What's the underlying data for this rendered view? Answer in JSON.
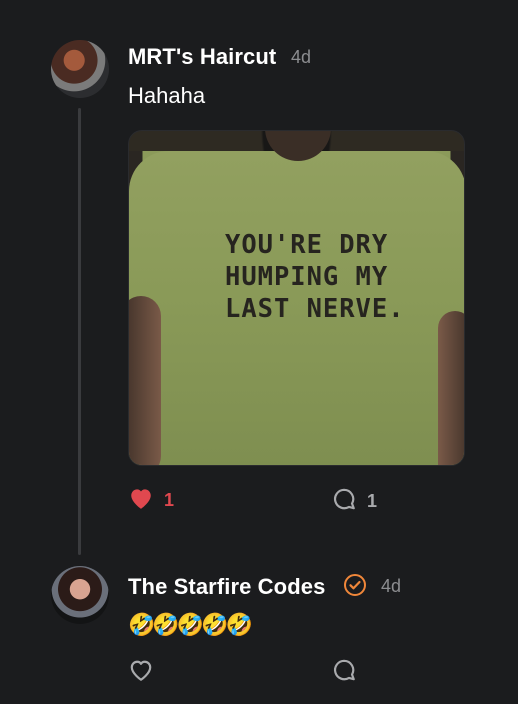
{
  "comments": [
    {
      "author": "MRT's Haircut",
      "time": "4d",
      "text": "Hahaha",
      "attachment": {
        "shirt_text": "YOU'RE DRY\nHUMPING MY\nLAST NERVE."
      },
      "likes": "1",
      "replies": "1",
      "liked": true,
      "avatar_icon": "avatar-photo"
    },
    {
      "author": "The Starfire Codes",
      "time": "4d",
      "verified_icon": "verified-check-icon",
      "text": "🤣🤣🤣🤣🤣",
      "avatar_icon": "avatar-photo"
    }
  ],
  "colors": {
    "background": "#1b1c1e",
    "like_active": "#e0484f",
    "muted": "#8c8d90",
    "verified": "#f0873a"
  }
}
